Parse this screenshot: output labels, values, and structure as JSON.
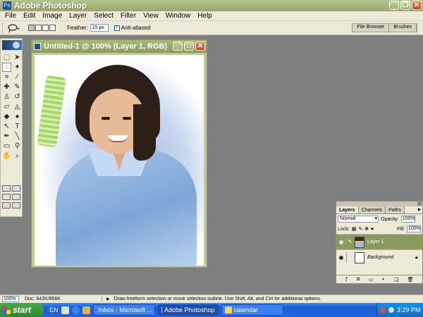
{
  "window": {
    "title": "Adobe Photoshop"
  },
  "menu": [
    "File",
    "Edit",
    "Image",
    "Layer",
    "Select",
    "Filter",
    "View",
    "Window",
    "Help"
  ],
  "options": {
    "feather_label": "Feather:",
    "feather_value": "15 px",
    "antialias_label": "Anti-aliased",
    "antialias_checked": true
  },
  "palette_well": [
    "File Browser",
    "Brushes"
  ],
  "document": {
    "title": "Untitled-1 @ 100% (Layer 1, RGB)"
  },
  "colors": {
    "foreground": "#e0175a",
    "background": "#ffffff",
    "accent": "#8a9a5a"
  },
  "layers_panel": {
    "tabs": [
      "Layers",
      "Channels",
      "Paths"
    ],
    "blend_mode": "Normal",
    "opacity_label": "Opacity:",
    "opacity_value": "100%",
    "lock_label": "Lock:",
    "fill_label": "Fill:",
    "fill_value": "100%",
    "layers": [
      {
        "name": "Layer 1",
        "visible": true,
        "selected": true
      },
      {
        "name": "Background",
        "visible": true,
        "selected": false,
        "locked": true
      }
    ]
  },
  "status": {
    "zoom": "100%",
    "doc_info": "Doc: 642K/856K",
    "message": "Draw freeform selection or move selection outline. Use Shift, Alt, and Ctrl for additional options."
  },
  "taskbar": {
    "start_label": "start",
    "language": "EN",
    "tasks": [
      {
        "label": "Inbox - Microsoft ...",
        "icon": "outlook-icon",
        "active": false
      },
      {
        "label": "Adobe Photoshop",
        "icon": "photoshop-icon",
        "active": true
      },
      {
        "label": "calendar",
        "icon": "folder-icon",
        "active": false
      }
    ],
    "clock": "3:29 PM"
  }
}
